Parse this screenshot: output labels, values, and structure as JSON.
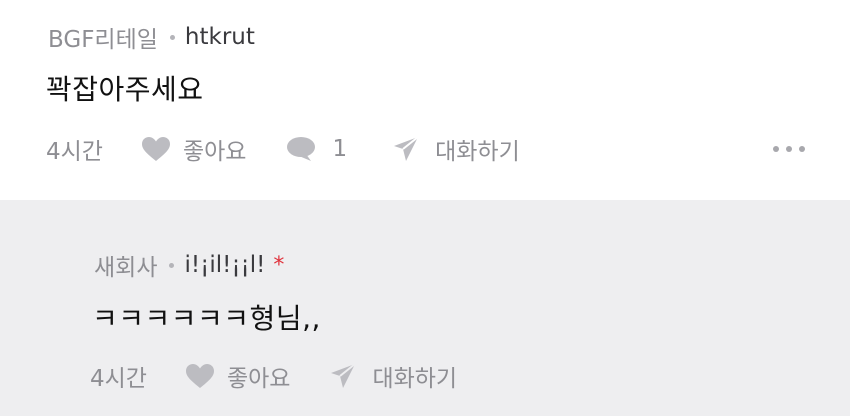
{
  "comments": [
    {
      "author": "BGF리테일",
      "nickname": "htkrut",
      "text": "꽉잡아주세요",
      "time": "4시간",
      "like_label": "좋아요",
      "reply_count": "1",
      "chat_label": "대화하기"
    },
    {
      "author": "새회사",
      "nickname": "i!¡il!¡¡l!",
      "badge": "*",
      "text": "ㅋㅋㅋㅋㅋㅋ형님,,",
      "time": "4시간",
      "like_label": "좋아요",
      "chat_label": "대화하기"
    }
  ],
  "colors": {
    "icon": "#bcbcc1",
    "meta": "#8e8e93",
    "reply_bg": "#eeeef0",
    "badge": "#e0323c"
  },
  "icons": [
    "heart-icon",
    "comment-bubble-icon",
    "send-icon",
    "more-icon"
  ]
}
